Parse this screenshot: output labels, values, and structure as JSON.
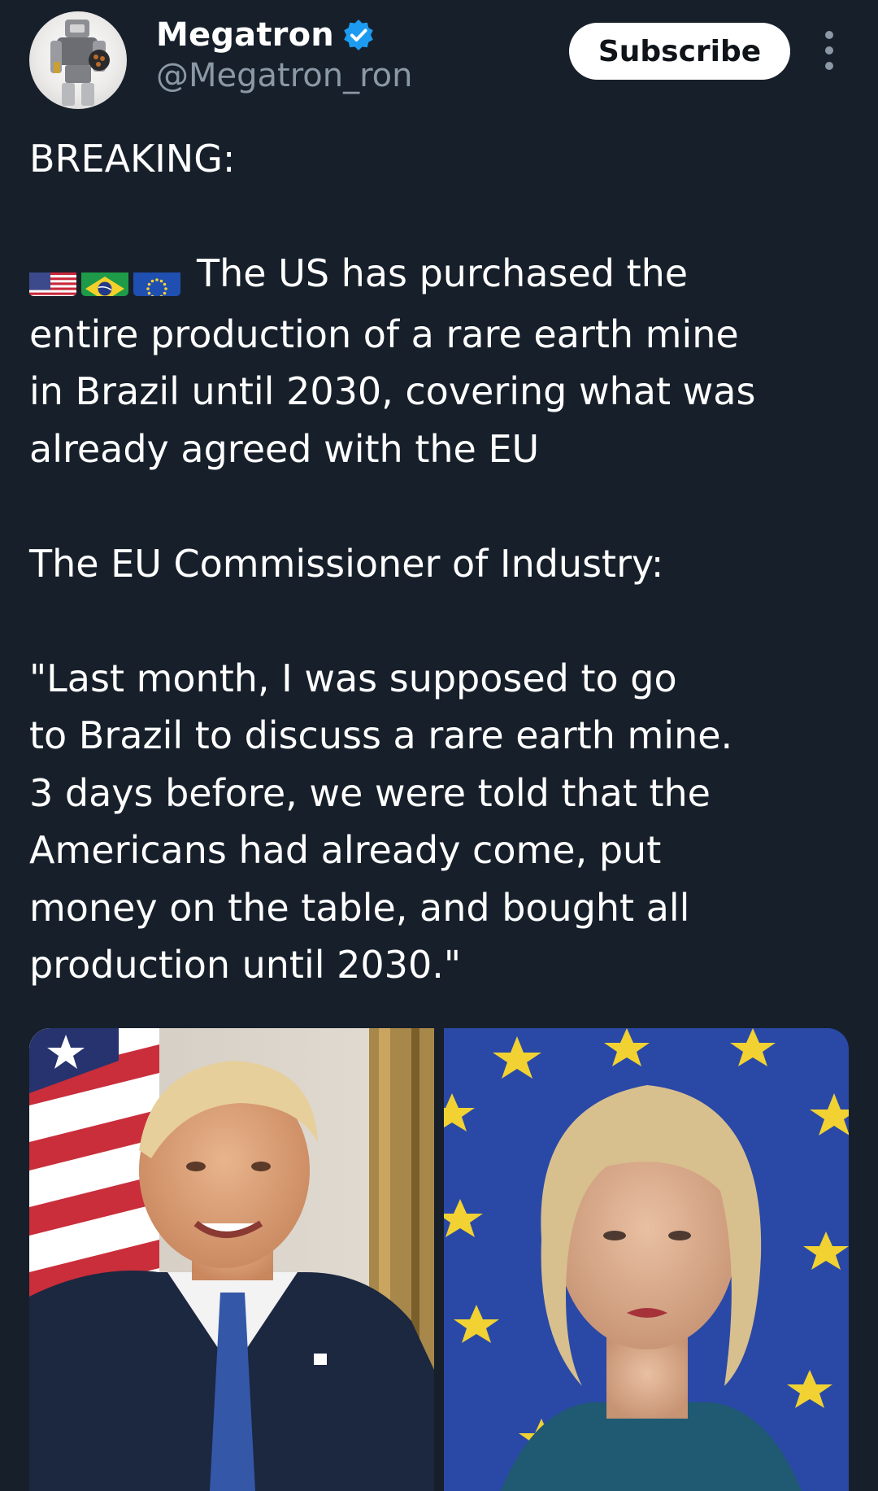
{
  "author": {
    "display_name": "Megatron",
    "handle": "@Megatron_ron",
    "verified": true,
    "avatar_icon": "robot-avatar-icon"
  },
  "actions": {
    "subscribe_label": "Subscribe",
    "more_icon": "more-vertical-icon"
  },
  "tweet": {
    "heading": "BREAKING:",
    "flags": [
      "us-flag-icon",
      "brazil-flag-icon",
      "eu-flag-icon"
    ],
    "paragraph_1": "The US has purchased the\nentire production of a rare earth mine\nin Brazil until 2030, covering what was\nalready agreed with the EU",
    "paragraph_2": "The EU Commissioner of Industry:",
    "quote": "\"Last month, I was supposed to go\nto Brazil to discuss a rare earth mine.\n3 days before, we were told that the\nAmericans had already come, put\nmoney on the table, and bought all\nproduction until 2030.\""
  },
  "media": {
    "photos": [
      "portrait-photo-left",
      "portrait-photo-right"
    ]
  },
  "colors": {
    "background": "#17202a",
    "text": "#ffffff",
    "secondary_text": "#8b98a5",
    "verified": "#1d9bf0",
    "button_bg": "#ffffff",
    "button_text": "#0f1419"
  }
}
